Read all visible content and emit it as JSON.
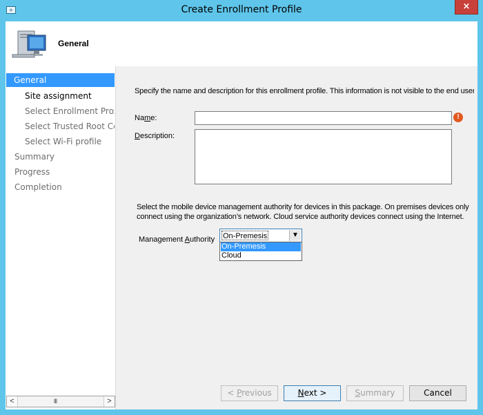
{
  "window": {
    "title": "Create Enrollment Profile",
    "close_glyph": "×"
  },
  "header": {
    "title": "General",
    "icon": "computer-wizard-icon"
  },
  "nav": {
    "items": [
      {
        "label": "General",
        "state": "active"
      },
      {
        "label": "Site assignment",
        "state": "current"
      },
      {
        "label": "Select Enrollment Proxy P",
        "state": "sub"
      },
      {
        "label": "Select Trusted Root Certi",
        "state": "sub"
      },
      {
        "label": "Select Wi-Fi profile",
        "state": "sub"
      },
      {
        "label": "Summary",
        "state": "top"
      },
      {
        "label": "Progress",
        "state": "top"
      },
      {
        "label": "Completion",
        "state": "top"
      }
    ],
    "scroll_left": "<",
    "scroll_right": ">",
    "scroll_grip": "III"
  },
  "form": {
    "intro": "Specify the name and description for this enrollment profile. This information is not visible to the end user",
    "name_label": "Name:",
    "name_value": "",
    "description_label": "Description:",
    "description_value": "",
    "error_glyph": "!",
    "mdm_text": "Select the mobile device management authority for devices in this package. On premises devices only connect using the organization’s network. Cloud service authority devices connect using the Internet.",
    "authority_label": "Management Authority",
    "authority_selected": "On-Premesis",
    "authority_options": [
      "On-Premesis",
      "Cloud"
    ],
    "dropdown_arrow": "▼"
  },
  "buttons": {
    "previous": "< Previous",
    "next": "Next >",
    "summary": "Summary",
    "cancel": "Cancel"
  },
  "colors": {
    "frame": "#5fc5ea",
    "selection": "#3399ff",
    "close": "#c7403a",
    "error": "#e2581e"
  }
}
